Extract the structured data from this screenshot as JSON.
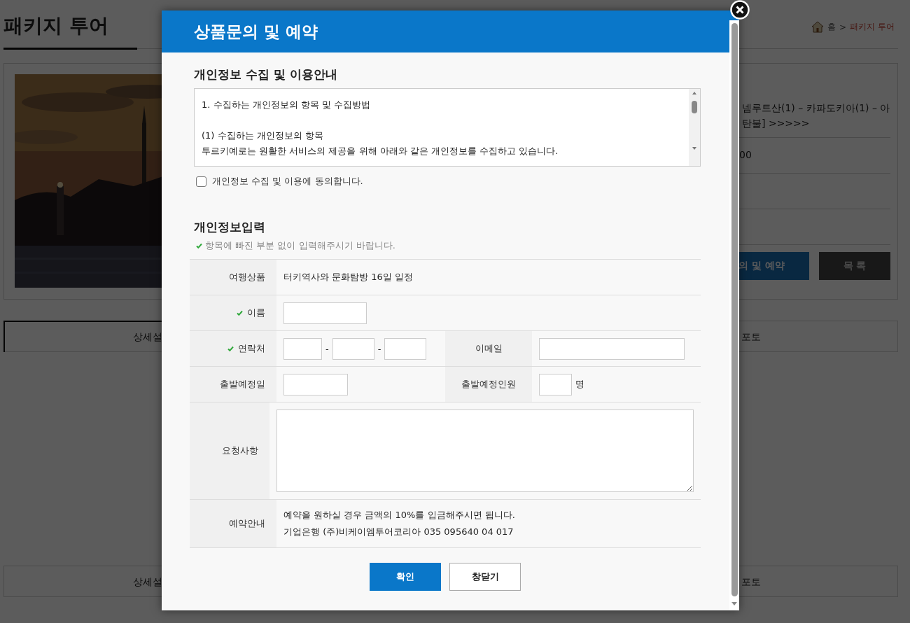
{
  "page": {
    "title": "패키지 투어",
    "breadcrumb": [
      "홈",
      ">",
      "패키지 투어"
    ],
    "product": {
      "rows": [
        {
          "lines": [
            "넴루트산(1) – 카파도키아(1) – 아",
            "탄불] >>>>>"
          ]
        },
        {
          "lines": [
            "00"
          ]
        },
        {
          "lines": []
        },
        {
          "lines": []
        }
      ],
      "buttons": [
        {
          "label": "의 및 예약",
          "kind": "primary"
        },
        {
          "label": "목 록",
          "kind": "dark"
        }
      ]
    },
    "tab_bars": [
      {
        "tabs": [
          {
            "label": "상세설",
            "selected": true
          },
          {
            "label": "포토",
            "selected": false
          }
        ]
      },
      {
        "tabs": [
          {
            "label": "상세설",
            "selected": false
          },
          {
            "label": "포토",
            "selected": false
          }
        ]
      }
    ]
  },
  "modal": {
    "title": "상품문의 및 예약",
    "privacy": {
      "heading": "개인정보 수집 및 이용안내",
      "paragraphs": [
        [
          "1. 수집하는 개인정보의 항목 및 수집방법"
        ],
        [
          "(1) 수집하는 개인정보의 항목",
          "투르키예로는 원활한 서비스의 제공을 위해 아래와 같은 개인정보를 수집하고 있습니다."
        ]
      ],
      "consent": {
        "label": "개인정보 수집 및 이용에 동의합니다.",
        "checked": false
      }
    },
    "form": {
      "heading": "개인정보입력",
      "note": "항목에 빠진 부분 없이 입력해주시기 바랍니다.",
      "rows": [
        {
          "kind": "text",
          "label": "여행상품",
          "required": false,
          "value": "터키역사와 문화탐방 16일 일정"
        },
        {
          "kind": "input",
          "label": "이름",
          "required": true
        },
        {
          "kind": "phone",
          "label": "연락처",
          "required": true,
          "separator": "-",
          "extra_label": "이메일"
        },
        {
          "kind": "date",
          "label": "출발예정일",
          "required": false,
          "extra_label": "출발예정인원",
          "unit": "명"
        },
        {
          "kind": "textarea",
          "label": "요청사항",
          "required": false
        },
        {
          "kind": "info",
          "label": "예약안내",
          "required": false,
          "lines": [
            "예약을 원하실 경우 금액의 10%를 입금해주시면 됩니다.",
            "기업은행 (주)비케이엠투어코리아 035 095640 04 017"
          ]
        }
      ]
    },
    "buttons": [
      {
        "label": "확인",
        "kind": "primary"
      },
      {
        "label": "창닫기",
        "kind": "secondary"
      }
    ]
  }
}
